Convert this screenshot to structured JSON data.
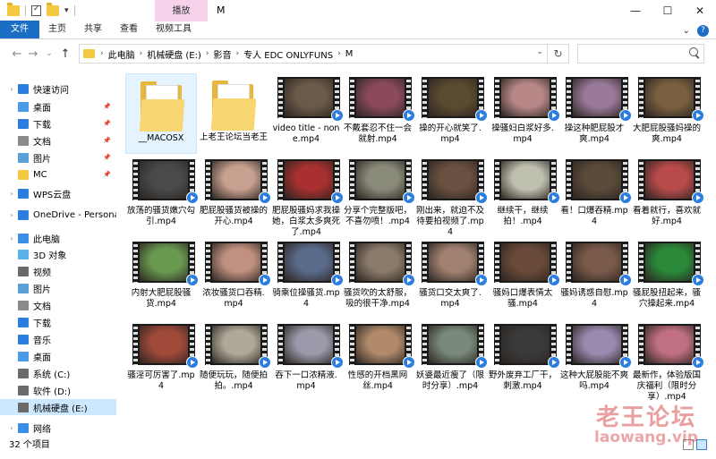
{
  "window": {
    "title": "M",
    "context_tab": "播放",
    "controls": [
      "—",
      "☐",
      "✕"
    ]
  },
  "ribbon": {
    "tabs": [
      "文件",
      "主页",
      "共享",
      "查看",
      "视频工具"
    ],
    "chevron": "⌄"
  },
  "address": {
    "crumbs": [
      "此电脑",
      "机械硬盘 (E:)",
      "影音",
      "专人 EDC ONLYFUNS",
      "M"
    ],
    "search_placeholder": ""
  },
  "sidebar": {
    "items": [
      {
        "label": "快速访问",
        "icon": "star-icon",
        "color": "#2b7de0",
        "pinned": false,
        "indent": 0,
        "expandable": true
      },
      {
        "label": "桌面",
        "icon": "desktop-icon",
        "color": "#4a9ae8",
        "pinned": true,
        "indent": 1
      },
      {
        "label": "下载",
        "icon": "download-icon",
        "color": "#2b7de0",
        "pinned": true,
        "indent": 1
      },
      {
        "label": "文档",
        "icon": "document-icon",
        "color": "#8a8a8a",
        "pinned": true,
        "indent": 1
      },
      {
        "label": "图片",
        "icon": "pictures-icon",
        "color": "#5aa0d8",
        "pinned": true,
        "indent": 1
      },
      {
        "label": "MC",
        "icon": "folder-icon",
        "color": "#f5c842",
        "pinned": true,
        "indent": 1
      },
      {
        "label": "WPS云盘",
        "icon": "cloud-icon",
        "color": "#2b7de0",
        "pinned": false,
        "indent": 0,
        "expandable": true
      },
      {
        "label": "OneDrive - Persona",
        "icon": "onedrive-icon",
        "color": "#2b7de0",
        "pinned": false,
        "indent": 0,
        "expandable": true
      },
      {
        "label": "此电脑",
        "icon": "pc-icon",
        "color": "#3a8ee6",
        "pinned": false,
        "indent": 0,
        "expandable": true
      },
      {
        "label": "3D 对象",
        "icon": "3d-objects-icon",
        "color": "#5ab0e8",
        "pinned": false,
        "indent": 1,
        "expandable": true
      },
      {
        "label": "视频",
        "icon": "video-icon",
        "color": "#6a6a6a",
        "pinned": false,
        "indent": 1,
        "expandable": true
      },
      {
        "label": "图片",
        "icon": "pictures-icon",
        "color": "#5aa0d8",
        "pinned": false,
        "indent": 1,
        "expandable": true
      },
      {
        "label": "文档",
        "icon": "document-icon",
        "color": "#8a8a8a",
        "pinned": false,
        "indent": 1,
        "expandable": true
      },
      {
        "label": "下载",
        "icon": "download-icon",
        "color": "#2b7de0",
        "pinned": false,
        "indent": 1,
        "expandable": true
      },
      {
        "label": "音乐",
        "icon": "music-icon",
        "color": "#2b7de0",
        "pinned": false,
        "indent": 1,
        "expandable": true
      },
      {
        "label": "桌面",
        "icon": "desktop-icon",
        "color": "#4a9ae8",
        "pinned": false,
        "indent": 1,
        "expandable": true
      },
      {
        "label": "系统 (C:)",
        "icon": "drive-c-icon",
        "color": "#6a6a6a",
        "pinned": false,
        "indent": 1,
        "expandable": true
      },
      {
        "label": "软件 (D:)",
        "icon": "drive-icon",
        "color": "#6a6a6a",
        "pinned": false,
        "indent": 1,
        "expandable": true
      },
      {
        "label": "机械硬盘 (E:)",
        "icon": "drive-icon",
        "color": "#6a6a6a",
        "pinned": false,
        "indent": 1,
        "expandable": true,
        "selected": true
      },
      {
        "label": "网络",
        "icon": "network-icon",
        "color": "#3a8ee6",
        "pinned": false,
        "indent": 0,
        "expandable": true
      }
    ]
  },
  "files": [
    {
      "name": "__MACOSX",
      "type": "folder"
    },
    {
      "name": "上老王论坛当老王",
      "type": "folder"
    },
    {
      "name": "video title - none.mp4",
      "type": "video",
      "tint": "#6b5a48"
    },
    {
      "name": "不戴套忍不住一会就射.mp4",
      "type": "video",
      "tint": "#8a4a5a"
    },
    {
      "name": "操的开心就笑了.mp4",
      "type": "video",
      "tint": "#5a4a30"
    },
    {
      "name": "操骚妇白浆好多.mp4",
      "type": "video",
      "tint": "#b88888"
    },
    {
      "name": "操这种肥屁股才爽.mp4",
      "type": "video",
      "tint": "#9a7a9a"
    },
    {
      "name": "大肥屁股骚妈操的爽.mp4",
      "type": "video",
      "tint": "#7a6040"
    },
    {
      "name": "放荡的骚货嫩穴勾引.mp4",
      "type": "video",
      "tint": "#4a4a4a"
    },
    {
      "name": "肥屁股骚货被操的开心.mp4",
      "type": "video",
      "tint": "#c8a090"
    },
    {
      "name": "肥屁股骚妈求我操她，白浆太多爽死了.mp4",
      "type": "video",
      "tint": "#a83030"
    },
    {
      "name": "分享个完整版吧，不喜勿喷！.mp4",
      "type": "video",
      "tint": "#8a8a7a"
    },
    {
      "name": "刚出来，就迫不及待要拍视频了.mp4",
      "type": "video",
      "tint": "#6a5040"
    },
    {
      "name": "继续干，继续拍！.mp4",
      "type": "video",
      "tint": "#c0c0b0"
    },
    {
      "name": "看！口爆吞精.mp4",
      "type": "video",
      "tint": "#5a4a3a"
    },
    {
      "name": "看着就行，喜欢就好.mp4",
      "type": "video",
      "tint": "#b84a4a"
    },
    {
      "name": "内射大肥屁股骚货.mp4",
      "type": "video",
      "tint": "#6a9a50"
    },
    {
      "name": "浓妆骚货口吞精.mp4",
      "type": "video",
      "tint": "#c09080"
    },
    {
      "name": "骑乘位操骚货.mp4",
      "type": "video",
      "tint": "#5a6a8a"
    },
    {
      "name": "骚货吹的太舒服，吸的很干净.mp4",
      "type": "video",
      "tint": "#8a7a6a"
    },
    {
      "name": "骚货口交太爽了.mp4",
      "type": "video",
      "tint": "#a08070"
    },
    {
      "name": "骚妈口爆表情太骚.mp4",
      "type": "video",
      "tint": "#6a4a3a"
    },
    {
      "name": "骚妈诱惑自慰.mp4",
      "type": "video",
      "tint": "#7a5a4a"
    },
    {
      "name": "骚屁股扭起来，骚穴操起来.mp4",
      "type": "video",
      "tint": "#2a8a3a"
    },
    {
      "name": "骚淫可厉害了.mp4",
      "type": "video",
      "tint": "#a04a3a"
    },
    {
      "name": "随便玩玩，随便拍拍。.mp4",
      "type": "video",
      "tint": "#b0a898"
    },
    {
      "name": "吞下一口浓精液.mp4",
      "type": "video",
      "tint": "#9a9aaa"
    },
    {
      "name": "性感的开档黑网丝.mp4",
      "type": "video",
      "tint": "#b08a6a"
    },
    {
      "name": "妖婆最近瘦了（限时分享）.mp4",
      "type": "video",
      "tint": "#7a8a7a"
    },
    {
      "name": "野外废弃工厂干，刺激.mp4",
      "type": "video",
      "tint": "#3a3a3a"
    },
    {
      "name": "这种大屁股能不爽吗.mp4",
      "type": "video",
      "tint": "#9a8ab0"
    },
    {
      "name": "最新作，体验版国庆福利（限时分享）.mp4",
      "type": "video",
      "tint": "#c07080"
    }
  ],
  "status": {
    "count": "32 个项目"
  },
  "watermark": {
    "line1": "老王论坛",
    "line2": "laowang.vip"
  }
}
